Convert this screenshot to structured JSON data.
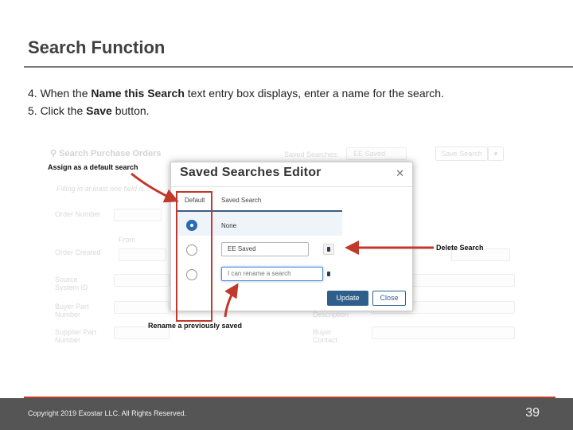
{
  "slide": {
    "title": "Search Function",
    "steps": [
      {
        "pre": "4. When the ",
        "bold": "Name this Search",
        "post": " text entry box displays, enter a name for the search."
      },
      {
        "pre": "5. Click the ",
        "bold": "Save",
        "post": " button."
      }
    ]
  },
  "background_page": {
    "heading": "Search Purchase Orders",
    "saved_searches_label": "Saved Searches:",
    "saved_searches_value": "EE Saved",
    "save_search_button": "Save Search",
    "hint": "Filling in at least one field is...",
    "fields_left": [
      "Order Number",
      "Order Created",
      "Source System ID",
      "Buyer Part Number",
      "Supplier Part Number"
    ],
    "from_label": "From",
    "fields_right": [
      "Description",
      "Buyer Contact"
    ]
  },
  "modal": {
    "title": "Saved Searches Editor",
    "col_default": "Default",
    "col_saved": "Saved Search",
    "rows": [
      {
        "name": "None",
        "selected": true
      },
      {
        "name": "EE Saved",
        "selected": false
      },
      {
        "name": "I can rename a search",
        "selected": false
      }
    ],
    "update_button": "Update",
    "close_button": "Close"
  },
  "callouts": {
    "default_search": "Assign as a default search",
    "delete_search": "Delete Search",
    "rename": "Rename a previously saved"
  },
  "footer": {
    "copyright": "Copyright 2019 Exostar LLC. All Rights Reserved.",
    "page_number": "39"
  },
  "colors": {
    "callout_red": "#c0392b",
    "primary_blue": "#2e5f8a",
    "footer_bg": "#555555"
  }
}
